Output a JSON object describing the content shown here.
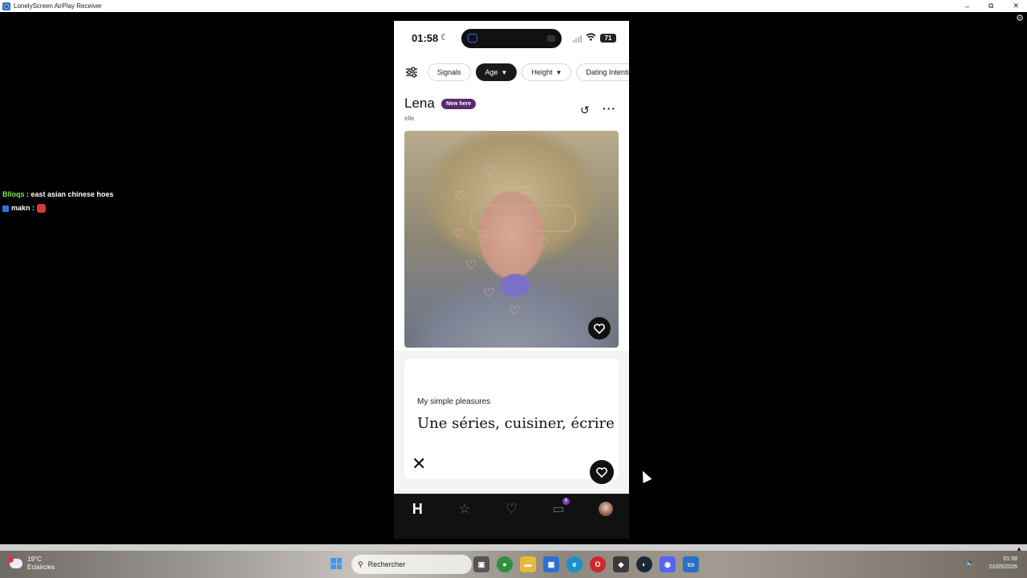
{
  "window": {
    "title": "LonelyScreen AirPlay Receiver",
    "minimize": "–",
    "restore": "⧉",
    "close": "✕"
  },
  "chat": [
    {
      "user": "Blloqs",
      "message": "east asian chinese hoes"
    },
    {
      "user": "makn",
      "message": ""
    }
  ],
  "phone": {
    "status": {
      "time": "01:58",
      "battery": "71"
    },
    "filters": [
      "Signals",
      "Age",
      "Height",
      "Dating Intentio"
    ],
    "active_filter": "Age",
    "profile": {
      "name": "Lena",
      "badge": "New here",
      "pronoun": "elle"
    },
    "prompt": {
      "question": "My simple pleasures",
      "answer": "Une séries, cuisiner, écrire"
    },
    "nav_badge": "6"
  },
  "taskbar": {
    "weather_temp": "19°C",
    "weather_desc": "Eclaircies",
    "search_placeholder": "Rechercher",
    "time": "01:58",
    "date": "01/05/2026"
  },
  "colors": {
    "badge_purple": "#5b2a6e",
    "nav_bg": "#111111",
    "chat_name": "#8be34a"
  }
}
